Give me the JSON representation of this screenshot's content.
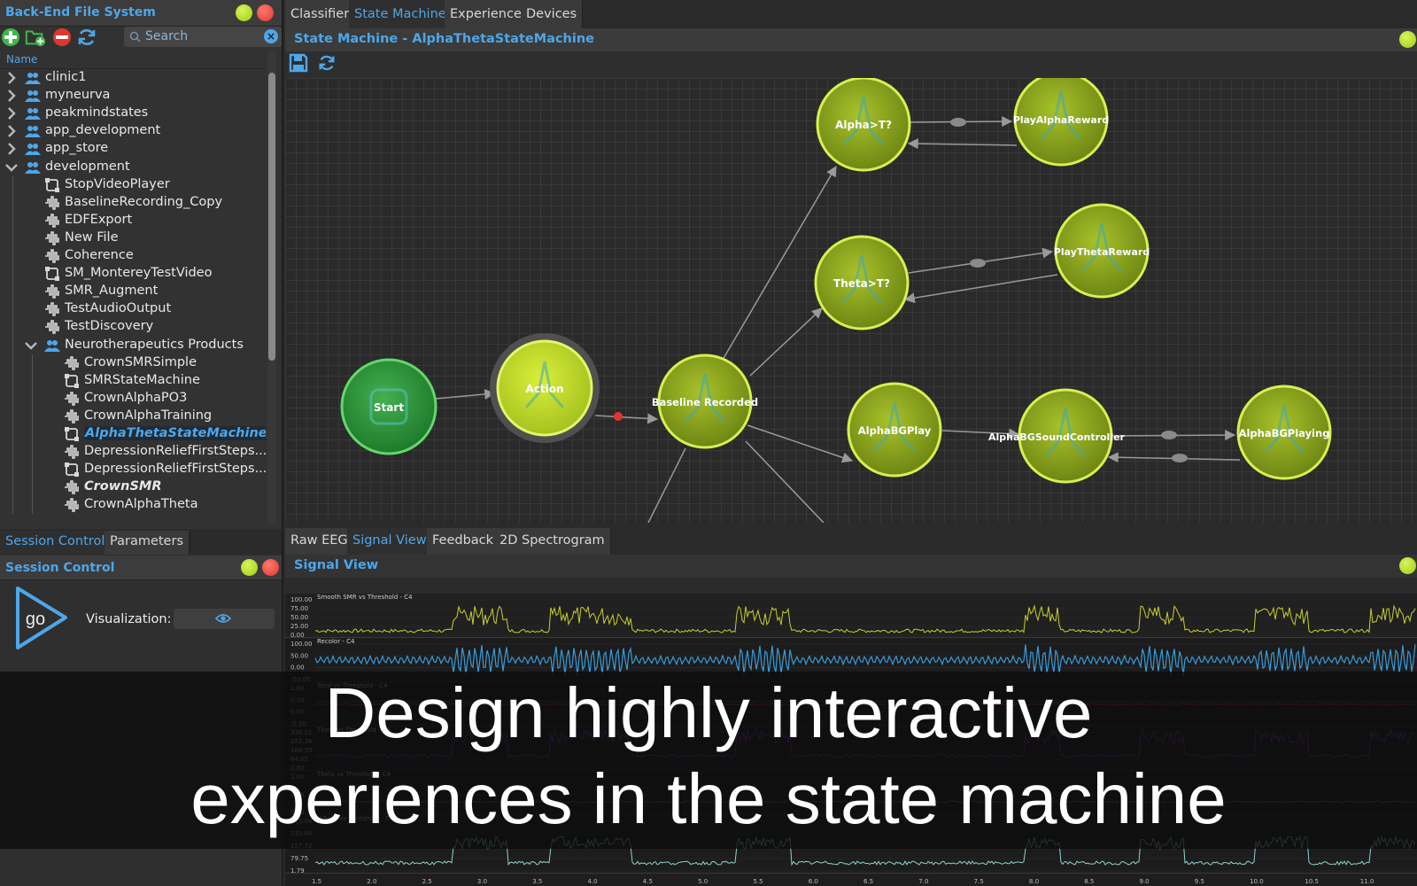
{
  "file_system": {
    "title": "Back-End File System",
    "search_placeholder": "Search",
    "column_header": "Name",
    "tree": [
      {
        "label": "clinic1",
        "depth": 0,
        "icon": "group-icon",
        "arrow": "right"
      },
      {
        "label": "myneurva",
        "depth": 0,
        "icon": "group-icon",
        "arrow": "right"
      },
      {
        "label": "peakmindstates",
        "depth": 0,
        "icon": "group-icon",
        "arrow": "right"
      },
      {
        "label": "app_development",
        "depth": 0,
        "icon": "group-icon",
        "arrow": "right"
      },
      {
        "label": "app_store",
        "depth": 0,
        "icon": "group-icon",
        "arrow": "right"
      },
      {
        "label": "development",
        "depth": 0,
        "icon": "group-icon",
        "arrow": "down"
      },
      {
        "label": "StopVideoPlayer",
        "depth": 1,
        "icon": "state-machine-icon"
      },
      {
        "label": "BaselineRecording_Copy",
        "depth": 1,
        "icon": "waveform-icon"
      },
      {
        "label": "EDFExport",
        "depth": 1,
        "icon": "waveform-icon"
      },
      {
        "label": "New File",
        "depth": 1,
        "icon": "waveform-icon"
      },
      {
        "label": "Coherence",
        "depth": 1,
        "icon": "waveform-icon"
      },
      {
        "label": "SM_MontereyTestVideo",
        "depth": 1,
        "icon": "state-machine-icon"
      },
      {
        "label": "SMR_Augment",
        "depth": 1,
        "icon": "waveform-icon"
      },
      {
        "label": "TestAudioOutput",
        "depth": 1,
        "icon": "waveform-icon"
      },
      {
        "label": "TestDiscovery",
        "depth": 1,
        "icon": "waveform-icon"
      },
      {
        "label": "Neurotherapeutics Products",
        "depth": 1,
        "icon": "group-icon",
        "arrow": "down"
      },
      {
        "label": "CrownSMRSimple",
        "depth": 2,
        "icon": "waveform-icon"
      },
      {
        "label": "SMRStateMachine",
        "depth": 2,
        "icon": "state-machine-icon"
      },
      {
        "label": "CrownAlphaPO3",
        "depth": 2,
        "icon": "waveform-icon"
      },
      {
        "label": "CrownAlphaTraining",
        "depth": 2,
        "icon": "waveform-icon"
      },
      {
        "label": "AlphaThetaStateMachine",
        "depth": 2,
        "icon": "state-machine-icon",
        "selected": true
      },
      {
        "label": "DepressionReliefFirstSteps...",
        "depth": 2,
        "icon": "waveform-icon"
      },
      {
        "label": "DepressionReliefFirstSteps...",
        "depth": 2,
        "icon": "state-machine-icon"
      },
      {
        "label": "CrownSMR",
        "depth": 2,
        "icon": "waveform-icon",
        "emphasis": true
      },
      {
        "label": "CrownAlphaTheta",
        "depth": 2,
        "icon": "waveform-icon"
      }
    ]
  },
  "session": {
    "tabs": [
      "Session Control",
      "Parameters"
    ],
    "title": "Session Control",
    "go_label": "go",
    "visualization_label": "Visualization:"
  },
  "top_tabs": [
    "Classifier",
    "State Machine",
    "Experience",
    "Devices"
  ],
  "state_machine": {
    "title": "State Machine - AlphaThetaStateMachine",
    "nodes": [
      {
        "id": "start",
        "label": "Start",
        "kind": "start"
      },
      {
        "id": "action",
        "label": "Action",
        "kind": "active"
      },
      {
        "id": "baseline",
        "label": "Baseline Recorded",
        "kind": "state"
      },
      {
        "id": "alpha",
        "label": "Alpha>T?",
        "kind": "state"
      },
      {
        "id": "playalpha",
        "label": "PlayAlphaReward",
        "kind": "state"
      },
      {
        "id": "theta",
        "label": "Theta>T?",
        "kind": "state"
      },
      {
        "id": "playtheta",
        "label": "PlayThetaReward",
        "kind": "state"
      },
      {
        "id": "alphabgplay",
        "label": "AlphaBGPlay",
        "kind": "state"
      },
      {
        "id": "soundctl",
        "label": "AlphaBGSoundController",
        "kind": "state"
      },
      {
        "id": "alphabgplaying",
        "label": "AlphaBGPlaying",
        "kind": "state"
      }
    ]
  },
  "bottom_tabs": [
    "Raw EEG",
    "Signal View",
    "Feedback",
    "2D Spectrogram"
  ],
  "signal_view": {
    "title": "Signal View",
    "channels": [
      {
        "name": "Smooth SMR vs Threshold - C4",
        "color": "#c8cf2e",
        "ticks": [
          "100.00",
          "75.00",
          "50.00",
          "25.00",
          "0.00"
        ]
      },
      {
        "name": "Recolor - C4",
        "color": "#3a9bd8",
        "ticks": [
          "100.00",
          "50.00",
          "0.00",
          "-50.00"
        ]
      },
      {
        "name": "Total vs Threshold - C4",
        "color": "#cc3b3b",
        "ticks": [
          "1.00",
          "0.50",
          "0.00",
          "-0.50"
        ]
      },
      {
        "name": "Theta vs Threshold - C4",
        "color": "#8a2fc4",
        "ticks": [
          "336.21",
          "252.36",
          "168.50",
          "84.65",
          "0.80"
        ]
      },
      {
        "name": "Theta vs Threshold - C4",
        "color": "#2e8c6e",
        "ticks": [
          "1.00",
          "0.50",
          "0.00"
        ]
      },
      {
        "name": "HiBeta vs Threshold - C4",
        "color": "#8fd1cf",
        "ticks": [
          "313.64",
          "235.68",
          "157.72",
          "79.75",
          "1.79"
        ]
      }
    ],
    "x_ticks": [
      "1.5",
      "2.0",
      "2.5",
      "3.0",
      "3.5",
      "4.0",
      "4.5",
      "5.0",
      "5.5",
      "6.0",
      "6.5",
      "7.0",
      "7.5",
      "8.0",
      "8.5",
      "9.0",
      "9.5",
      "10.0",
      "10.5",
      "11.0"
    ]
  },
  "caption": {
    "line1": "Design highly interactive",
    "line2": "experiences in the state machine"
  },
  "colors": {
    "accent": "#4fa6e8",
    "node_fill": "#7f9a1a",
    "node_ring": "#d8f050",
    "start_fill": "#2a8c3a",
    "status_green": "#b8e02a",
    "status_red": "#e0372d"
  }
}
